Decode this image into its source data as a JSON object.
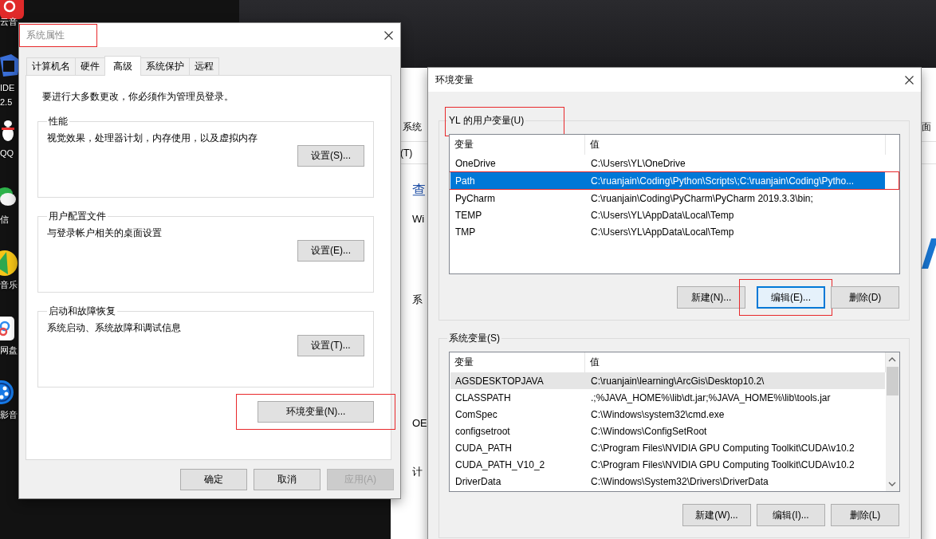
{
  "desktop": {
    "icons": [
      {
        "kind": "red-round",
        "label": "云音"
      },
      {
        "kind": "blue-square",
        "label": "IDE",
        "sublabel": "2.5"
      },
      {
        "kind": "penguin",
        "label": "QQ"
      },
      {
        "kind": "chat",
        "label": "信"
      },
      {
        "kind": "yellow-round",
        "label": "音乐"
      },
      {
        "kind": "cloud",
        "label": "网盘"
      },
      {
        "kind": "blue-round",
        "label": "影音"
      }
    ]
  },
  "background_window": {
    "breadcrumb": "系统",
    "breadcrumb_end": "面",
    "menu_item": "(T)",
    "heading": "查",
    "labels": [
      "Wi",
      "系",
      "OE",
      "计"
    ]
  },
  "system_properties": {
    "title": "系统属性",
    "title_highlighted": true,
    "tabs": [
      {
        "label": "计算机名",
        "selected": false
      },
      {
        "label": "硬件",
        "selected": false
      },
      {
        "label": "高级",
        "selected": true
      },
      {
        "label": "系统保护",
        "selected": false
      },
      {
        "label": "远程",
        "selected": false
      }
    ],
    "notice": "要进行大多数更改，你必须作为管理员登录。",
    "groups": [
      {
        "title": "性能",
        "description": "视觉效果，处理器计划，内存使用，以及虚拟内存",
        "button": "设置(S)..."
      },
      {
        "title": "用户配置文件",
        "description": "与登录帐户相关的桌面设置",
        "button": "设置(E)..."
      },
      {
        "title": "启动和故障恢复",
        "description": "系统启动、系统故障和调试信息",
        "button": "设置(T)..."
      }
    ],
    "env_button": {
      "label": "环境变量(N)...",
      "highlighted": true
    },
    "buttons": [
      {
        "label": "确定",
        "disabled": false
      },
      {
        "label": "取消",
        "disabled": false
      },
      {
        "label": "应用(A)",
        "disabled": true
      }
    ]
  },
  "environment_variables": {
    "title": "环境变量",
    "user_vars": {
      "title": "YL 的用户变量(U)",
      "highlighted": true,
      "columns": [
        "变量",
        "值"
      ],
      "rows": [
        {
          "name": "OneDrive",
          "value": "C:\\Users\\YL\\OneDrive",
          "selected": false,
          "highlighted": false
        },
        {
          "name": "Path",
          "value": "C:\\ruanjain\\Coding\\Python\\Scripts\\;C:\\ruanjain\\Coding\\Pytho...",
          "selected": true,
          "highlighted": true
        },
        {
          "name": "PyCharm",
          "value": "C:\\ruanjain\\Coding\\PyCharm\\PyCharm 2019.3.3\\bin;",
          "selected": false,
          "highlighted": false
        },
        {
          "name": "TEMP",
          "value": "C:\\Users\\YL\\AppData\\Local\\Temp",
          "selected": false,
          "highlighted": false
        },
        {
          "name": "TMP",
          "value": "C:\\Users\\YL\\AppData\\Local\\Temp",
          "selected": false,
          "highlighted": false
        }
      ],
      "buttons": [
        {
          "label": "新建(N)...",
          "focused": false,
          "highlighted": false
        },
        {
          "label": "编辑(E)...",
          "focused": true,
          "highlighted": true
        },
        {
          "label": "删除(D)",
          "focused": false,
          "highlighted": false
        }
      ]
    },
    "system_vars": {
      "title": "系统变量(S)",
      "columns": [
        "变量",
        "值"
      ],
      "rows": [
        {
          "name": "AGSDESKTOPJAVA",
          "value": "C:\\ruanjain\\learning\\ArcGis\\Desktop10.2\\",
          "selected": false,
          "hovered": true
        },
        {
          "name": "CLASSPATH",
          "value": ".;%JAVA_HOME%\\lib\\dt.jar;%JAVA_HOME%\\lib\\tools.jar",
          "selected": false,
          "hovered": false
        },
        {
          "name": "ComSpec",
          "value": "C:\\Windows\\system32\\cmd.exe",
          "selected": false,
          "hovered": false
        },
        {
          "name": "configsetroot",
          "value": "C:\\Windows\\ConfigSetRoot",
          "selected": false,
          "hovered": false
        },
        {
          "name": "CUDA_PATH",
          "value": "C:\\Program Files\\NVIDIA GPU Computing Toolkit\\CUDA\\v10.2",
          "selected": false,
          "hovered": false
        },
        {
          "name": "CUDA_PATH_V10_2",
          "value": "C:\\Program Files\\NVIDIA GPU Computing Toolkit\\CUDA\\v10.2",
          "selected": false,
          "hovered": false
        },
        {
          "name": "DriverData",
          "value": "C:\\Windows\\System32\\Drivers\\DriverData",
          "selected": false,
          "hovered": false
        }
      ],
      "buttons": [
        {
          "label": "新建(W)...",
          "focused": false
        },
        {
          "label": "编辑(I)...",
          "focused": false
        },
        {
          "label": "删除(L)",
          "focused": false
        }
      ]
    }
  }
}
